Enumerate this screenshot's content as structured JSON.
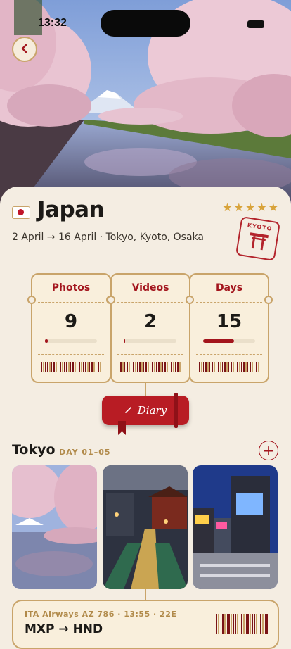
{
  "status_bar": {
    "time": "13:32"
  },
  "trip": {
    "title": "Japan",
    "meta": "2 April → 16 April · Tokyo, Kyoto, Osaka",
    "rating": 5,
    "stamp_label": "KYOTO"
  },
  "stats": [
    {
      "label": "Photos",
      "value": "9",
      "progress": 0.05
    },
    {
      "label": "Videos",
      "value": "2",
      "progress": 0.02
    },
    {
      "label": "Days",
      "value": "15",
      "progress": 0.6
    }
  ],
  "diary_button": {
    "label": "Diary"
  },
  "section": {
    "title": "Tokyo",
    "days": "DAY 01–05"
  },
  "photos": [
    "cherry-blossom-river",
    "asakusa-street-night",
    "shibuya-crossing"
  ],
  "flight": {
    "info": "ITA Airways AZ 786 · 13:55 · 22E",
    "route": "MXP → HND"
  },
  "colors": {
    "accent": "#a3151d",
    "gold": "#c9a46a",
    "background": "#f4ede2"
  }
}
